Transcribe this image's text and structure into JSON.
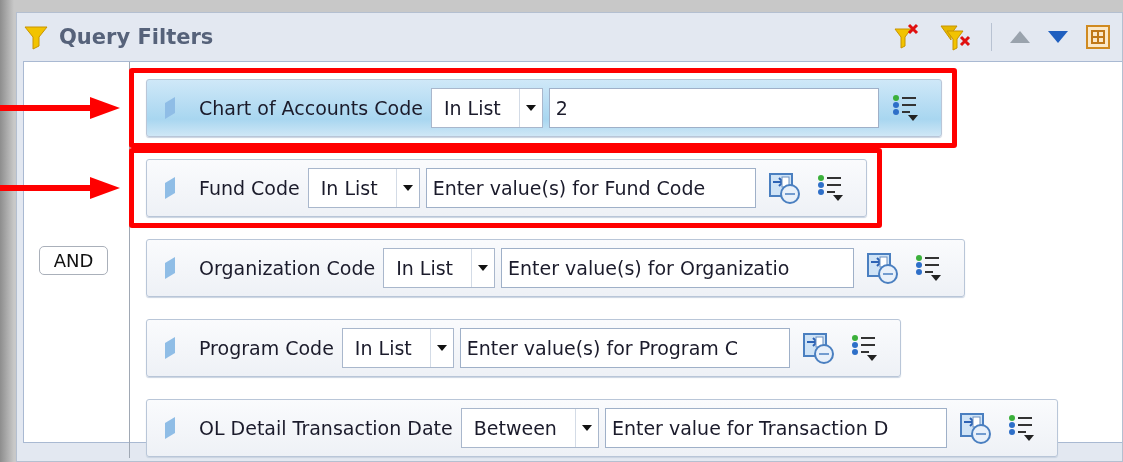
{
  "panel": {
    "title": "Query Filters"
  },
  "conjunction": "AND",
  "filters": [
    {
      "field": "Chart of Accounts Code",
      "operator": "In List",
      "value": "2",
      "selected": true,
      "highlighted": true
    },
    {
      "field": "Fund Code",
      "operator": "In List",
      "placeholder": "Enter value(s) for Fund Code",
      "selected": false,
      "highlighted": true
    },
    {
      "field": "Organization Code",
      "operator": "In List",
      "placeholder": "Enter value(s) for Organizatio",
      "selected": false,
      "highlighted": false
    },
    {
      "field": "Program Code",
      "operator": "In List",
      "placeholder": "Enter value(s) for Program C",
      "selected": false,
      "highlighted": false
    },
    {
      "field": "OL Detail Transaction Date",
      "operator": "Between",
      "placeholder": "Enter value for Transaction D",
      "selected": false,
      "highlighted": false
    }
  ]
}
